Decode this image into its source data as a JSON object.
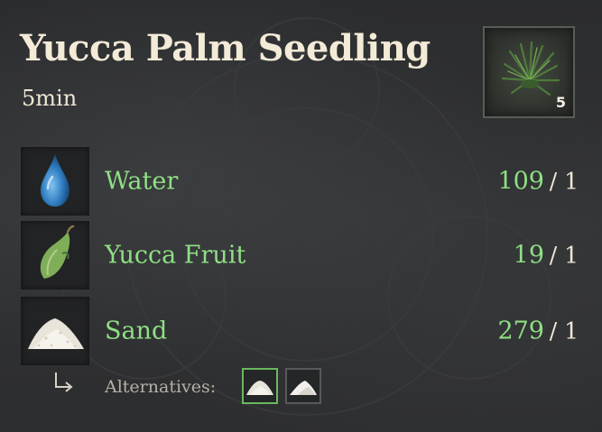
{
  "recipe": {
    "title": "Yucca Palm Seedling",
    "duration": "5min",
    "product": {
      "icon": "yucca-palm-seedling-icon",
      "quantity": "5"
    }
  },
  "ingredients": [
    {
      "name": "Water",
      "icon": "water-drop-icon",
      "available": "109",
      "required": "/ 1"
    },
    {
      "name": "Yucca Fruit",
      "icon": "yucca-fruit-icon",
      "available": "19",
      "required": "/ 1"
    },
    {
      "name": "Sand",
      "icon": "sand-pile-icon",
      "available": "279",
      "required": "/ 1"
    }
  ],
  "alternatives": {
    "label": "Alternatives:",
    "items": [
      {
        "icon": "sand-pile-icon",
        "selected": true
      },
      {
        "icon": "white-sand-pile-icon",
        "selected": false
      }
    ]
  },
  "colors": {
    "ingredient_text": "#8fe084",
    "title_text": "#f3ead7",
    "selected_border": "#6ab85e"
  }
}
